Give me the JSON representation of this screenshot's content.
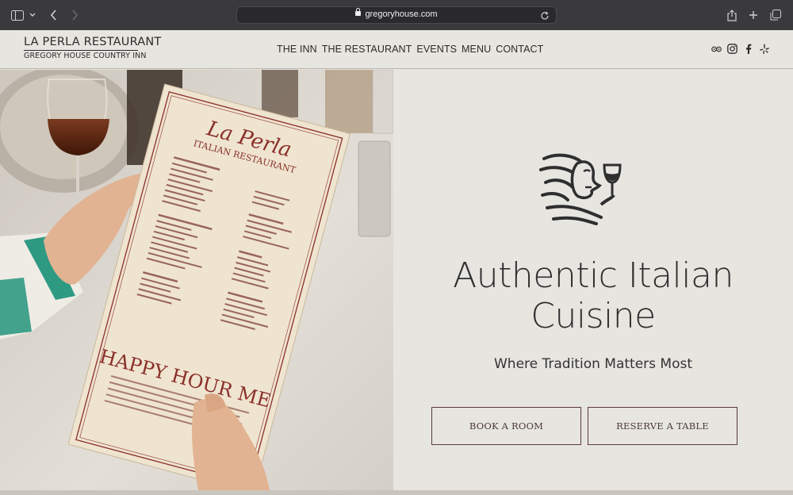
{
  "browser": {
    "url": "gregoryhouse.com"
  },
  "header": {
    "logo_top": "LA PERLA RESTAURANT",
    "logo_bottom": "GREGORY HOUSE COUNTRY INN",
    "nav": [
      {
        "label": "THE INN"
      },
      {
        "label": "THE RESTAURANT"
      },
      {
        "label": "EVENTS"
      },
      {
        "label": "MENU"
      },
      {
        "label": "CONTACT"
      }
    ],
    "social_icons": [
      "tripadvisor-icon",
      "instagram-icon",
      "facebook-icon",
      "yelp-icon"
    ]
  },
  "menu_card": {
    "brand": "La Perla",
    "subtitle": "ITALIAN RESTAURANT",
    "footer": "HAPPY HOUR ME"
  },
  "hero": {
    "headline_line1": "Authentic Italian",
    "headline_line2": "Cuisine",
    "subhead": "Where Tradition Matters Most",
    "book_button": "BOOK A ROOM",
    "reserve_button": "RESERVE A TABLE"
  },
  "colors": {
    "page_bg": "#e7e5e0",
    "button_border": "#5a3a36",
    "menu_red": "#8a2f2a"
  }
}
